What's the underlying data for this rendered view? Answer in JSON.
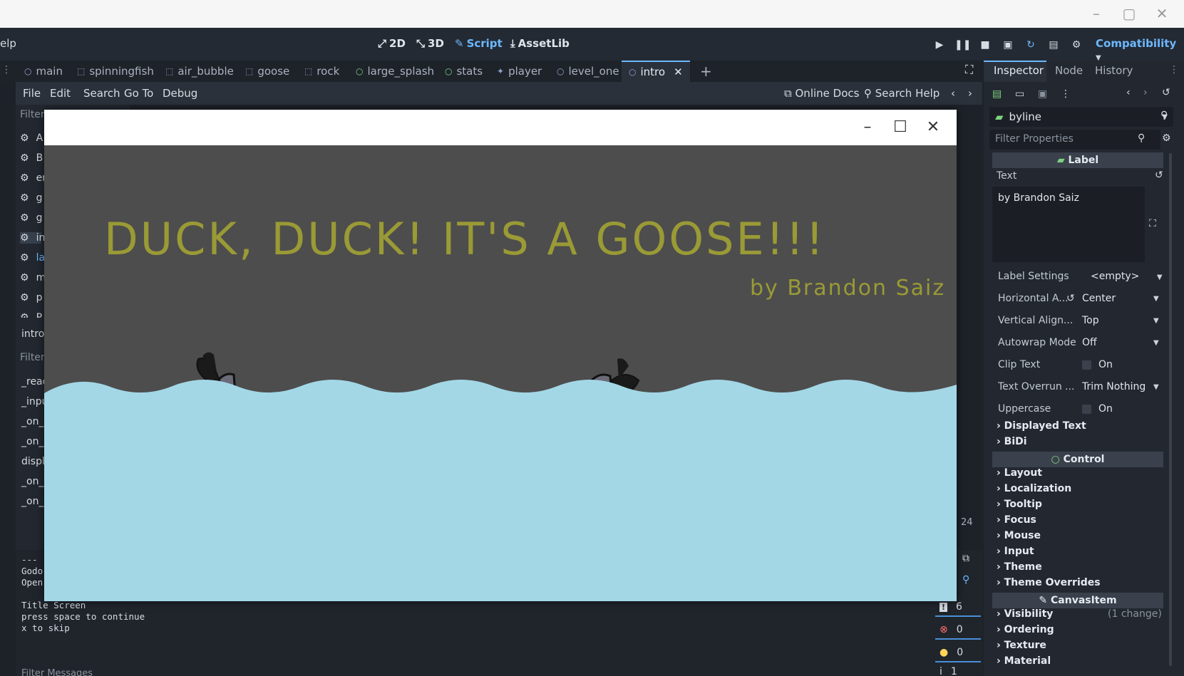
{
  "os": {
    "minimize": "–",
    "maximize": "▢",
    "close": "✕"
  },
  "menu": {
    "help": "elp"
  },
  "workspaces": {
    "d2": "2D",
    "d3": "3D",
    "script": "Script",
    "assetlib": "AssetLib"
  },
  "renderer": "Compatibility",
  "tabs": [
    "main",
    "spinningfish",
    "air_bubble",
    "goose",
    "rock",
    "large_splash",
    "stats",
    "player",
    "level_one",
    "intro"
  ],
  "script_menu": {
    "file": "File",
    "edit": "Edit",
    "search": "Search",
    "goto": "Go To",
    "debug": "Debug",
    "online_docs": "Online Docs",
    "search_help": "Search Help"
  },
  "left_panel": {
    "filter": "Filter",
    "scripts": [
      "A",
      "B",
      "er",
      "g",
      "g",
      "in",
      "la",
      "m",
      "p",
      "P"
    ],
    "current": "intro",
    "filter2": "Filter",
    "methods": [
      "_read",
      "_inpu",
      "_on_t",
      "_on_c",
      "displ",
      "_on_t",
      "_on_c"
    ]
  },
  "line_number": "24",
  "console": {
    "lines": [
      "---",
      "Godo",
      "Open",
      "",
      "Title Screen",
      "press space to continue",
      " x to skip"
    ],
    "filter": "Filter Messages"
  },
  "counters": {
    "messages": "6",
    "errors": "0",
    "warnings": "0",
    "other": "1"
  },
  "inspector": {
    "tabs": {
      "inspector": "Inspector",
      "node": "Node",
      "history": "History"
    },
    "node_name": "byline",
    "filter_placeholder": "Filter Properties",
    "section_label": "Label",
    "text_label": "Text",
    "text_value": "by Brandon Saiz",
    "props": [
      {
        "label": "Label Settings",
        "value": "<empty>"
      },
      {
        "label": "Horizontal A...",
        "value": "Center"
      },
      {
        "label": "Vertical Align...",
        "value": "Top"
      },
      {
        "label": "Autowrap Mode",
        "value": "Off"
      },
      {
        "label": "Clip Text",
        "value": "On"
      },
      {
        "label": "Text Overrun ...",
        "value": "Trim Nothing"
      },
      {
        "label": "Uppercase",
        "value": "On"
      }
    ],
    "label_groups": [
      "Displayed Text",
      "BiDi"
    ],
    "section_control": "Control",
    "control_groups": [
      "Layout",
      "Localization",
      "Tooltip",
      "Focus",
      "Mouse",
      "Input",
      "Theme",
      "Theme Overrides"
    ],
    "section_canvas": "CanvasItem",
    "canvas_groups": [
      "Visibility",
      "Ordering",
      "Texture",
      "Material"
    ],
    "visibility_note": "(1 change)"
  },
  "game": {
    "title": "DUCK, DUCK! IT'S A GOOSE!!!",
    "byline": "by Brandon Saiz",
    "text_color": "#9a9a36",
    "water_color": "#a3d7e6",
    "sky_color": "#4d4d4d"
  }
}
